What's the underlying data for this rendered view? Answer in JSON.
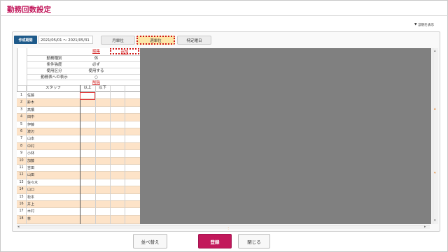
{
  "page": {
    "title": "勤務回数設定"
  },
  "help": {
    "label": "説明を表示"
  },
  "period": {
    "label": "作成期間",
    "value": "2021/05/01 ～ 2021/05/31"
  },
  "tabs": {
    "monthly": "月単位",
    "weekly": "週単位",
    "specific": "特定曜日"
  },
  "grid": {
    "header_rows": [
      {
        "label": "",
        "value": "編集"
      },
      {
        "label": "勤務種別",
        "value": "休"
      },
      {
        "label": "条件強度",
        "value": "必ず"
      },
      {
        "label": "使用区分",
        "value": "使用する"
      },
      {
        "label": "勤務表への表示",
        "value": "○"
      },
      {
        "label": "",
        "value": "削除"
      }
    ],
    "add_label": "追加",
    "columns": {
      "staff": "スタッフ",
      "min": "以上",
      "max": "以下"
    },
    "rows": [
      {
        "no": "1",
        "name": "佐藤"
      },
      {
        "no": "2",
        "name": "鈴木"
      },
      {
        "no": "3",
        "name": "高橋"
      },
      {
        "no": "4",
        "name": "田中"
      },
      {
        "no": "5",
        "name": "伊藤"
      },
      {
        "no": "6",
        "name": "渡辺"
      },
      {
        "no": "7",
        "name": "山本"
      },
      {
        "no": "8",
        "name": "中村"
      },
      {
        "no": "9",
        "name": "小林"
      },
      {
        "no": "10",
        "name": "加藤"
      },
      {
        "no": "11",
        "name": "吉田"
      },
      {
        "no": "12",
        "name": "山田"
      },
      {
        "no": "13",
        "name": "佐々木"
      },
      {
        "no": "14",
        "name": "山口"
      },
      {
        "no": "15",
        "name": "松本"
      },
      {
        "no": "16",
        "name": "井上"
      },
      {
        "no": "17",
        "name": "木村"
      },
      {
        "no": "18",
        "name": "林"
      }
    ]
  },
  "buttons": {
    "sort": "並べ替え",
    "register": "登録",
    "close": "閉じる"
  },
  "colors": {
    "accent": "#c2185b",
    "period_label_bg": "#1e5a8a",
    "highlight": "#d01818",
    "row_alt": "#fde3c8"
  }
}
